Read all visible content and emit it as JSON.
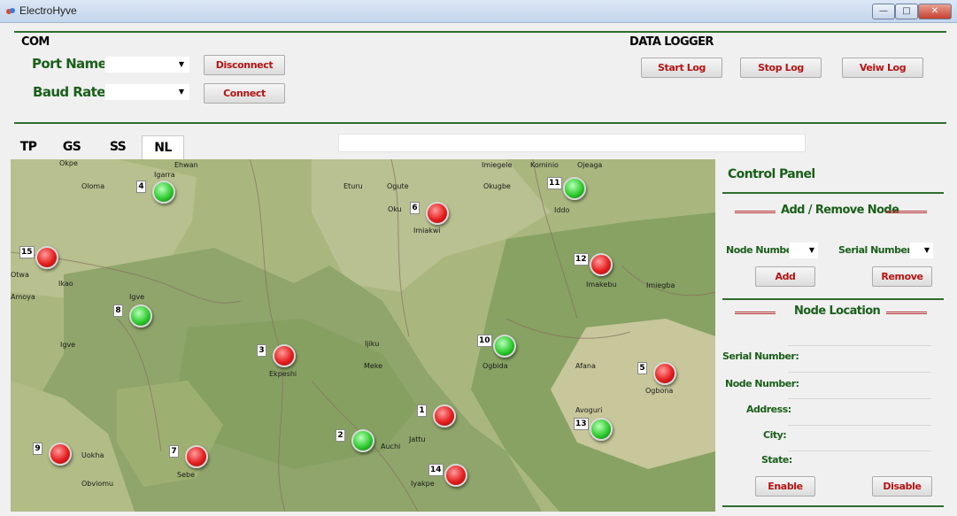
{
  "window": {
    "title": "ElectroHyve",
    "minimize": "—",
    "maximize": "□",
    "close": "✕"
  },
  "com": {
    "title": "COM",
    "port_label": "Port Name:",
    "baud_label": "Baud Rate:",
    "port_value": "",
    "baud_value": "",
    "disconnect": "Disconnect",
    "connect": "Connect"
  },
  "logger": {
    "title": "DATA LOGGER",
    "start": "Start Log",
    "stop": "Stop Log",
    "view": "Veiw Log"
  },
  "tabs": [
    {
      "label": "TP",
      "active": false
    },
    {
      "label": "GS",
      "active": false
    },
    {
      "label": "SS",
      "active": false
    },
    {
      "label": "NL",
      "active": true
    }
  ],
  "tab_field_value": "",
  "map": {
    "places": [
      "Okpe",
      "Ehwan",
      "Igarra",
      "Oloma",
      "Eturu",
      "Ogute",
      "Imiegele",
      "Kominio",
      "Ojeaga",
      "Okugbe",
      "Oku",
      "Iddo",
      "Imiakwi",
      "Otwa",
      "Ikao",
      "Amoya",
      "Igve",
      "Imakebu",
      "Imiegba",
      "Igve",
      "Ijiku",
      "Meke",
      "Ogbida",
      "Afana",
      "Ekpeshi",
      "Ogbona",
      "Avoguri",
      "Jattu",
      "Auchi",
      "Uokha",
      "Sebe",
      "Obviomu",
      "Iyakpe"
    ],
    "nodes": [
      {
        "id": "1",
        "status": "red"
      },
      {
        "id": "2",
        "status": "green"
      },
      {
        "id": "3",
        "status": "red"
      },
      {
        "id": "4",
        "status": "green"
      },
      {
        "id": "5",
        "status": "red"
      },
      {
        "id": "6",
        "status": "red"
      },
      {
        "id": "7",
        "status": "red"
      },
      {
        "id": "8",
        "status": "green"
      },
      {
        "id": "9",
        "status": "red"
      },
      {
        "id": "10",
        "status": "green"
      },
      {
        "id": "11",
        "status": "green"
      },
      {
        "id": "12",
        "status": "red"
      },
      {
        "id": "13",
        "status": "green"
      },
      {
        "id": "14",
        "status": "red"
      },
      {
        "id": "15",
        "status": "red"
      }
    ]
  },
  "control_panel": {
    "title": "Control Panel",
    "add_remove_title": "Add / Remove Node",
    "node_number_label": "Node Number:",
    "serial_number_label": "Serial Number:",
    "node_number_value": "",
    "serial_number_value": "",
    "add": "Add",
    "remove": "Remove",
    "location_title": "Node Location",
    "fields": [
      {
        "label": "Serial Number:",
        "value": ""
      },
      {
        "label": "Node Number:",
        "value": ""
      },
      {
        "label": "Address:",
        "value": ""
      },
      {
        "label": "City:",
        "value": ""
      },
      {
        "label": "State:",
        "value": ""
      }
    ],
    "enable": "Enable",
    "disable": "Disable"
  },
  "colors": {
    "accent_green": "#2e6e2e",
    "button_text_red": "#b41414",
    "node_red": "#e61e1e",
    "node_green": "#2fcc2f"
  }
}
